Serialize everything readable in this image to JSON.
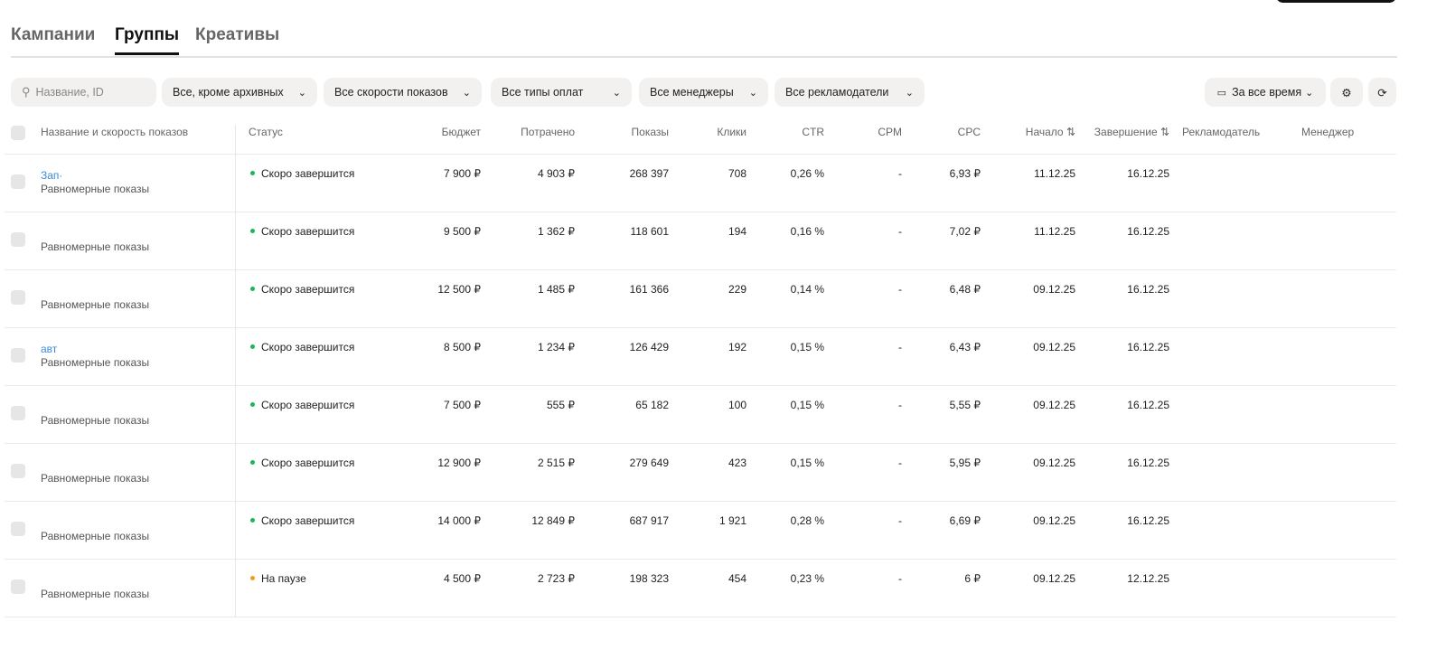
{
  "tabs": [
    "Кампании",
    "Группы",
    "Креативы"
  ],
  "filters": {
    "search_placeholder": "Название, ID",
    "status": "Все, кроме архивных",
    "speed": "Все скорости показов",
    "payment": "Все типы оплат",
    "managers": "Все менеджеры",
    "advertisers": "Все рекламодатели",
    "period": "За все время"
  },
  "columns": [
    "Название и скорость показов",
    "Статус",
    "Бюджет",
    "Потрачено",
    "Показы",
    "Клики",
    "CTR",
    "CPM",
    "CPC",
    "Начало ⇅",
    "Завершение ⇅",
    "Рекламодатель",
    "Менеджер"
  ],
  "colors": {
    "green": "#22b35a",
    "orange": "#f59a1b",
    "link": "#3a8bd6"
  },
  "rows": [
    {
      "name": "Зап·",
      "speed": "Равномерные показы",
      "status": "Скоро завершится",
      "status_color": "green",
      "budget": "7 900 ₽",
      "spent": "4 903 ₽",
      "shows": "268 397",
      "clicks": "708",
      "ctr": "0,26 %",
      "cpm": "-",
      "cpc": "6,93 ₽",
      "start": "11.12.25",
      "end": "16.12.25"
    },
    {
      "name": "",
      "speed": "Равномерные показы",
      "status": "Скоро завершится",
      "status_color": "green",
      "budget": "9 500 ₽",
      "spent": "1 362 ₽",
      "shows": "118 601",
      "clicks": "194",
      "ctr": "0,16 %",
      "cpm": "-",
      "cpc": "7,02 ₽",
      "start": "11.12.25",
      "end": "16.12.25"
    },
    {
      "name": "",
      "speed": "Равномерные показы",
      "status": "Скоро завершится",
      "status_color": "green",
      "budget": "12 500 ₽",
      "spent": "1 485 ₽",
      "shows": "161 366",
      "clicks": "229",
      "ctr": "0,14 %",
      "cpm": "-",
      "cpc": "6,48 ₽",
      "start": "09.12.25",
      "end": "16.12.25"
    },
    {
      "name": "авт",
      "speed": "Равномерные показы",
      "status": "Скоро завершится",
      "status_color": "green",
      "budget": "8 500 ₽",
      "spent": "1 234 ₽",
      "shows": "126 429",
      "clicks": "192",
      "ctr": "0,15 %",
      "cpm": "-",
      "cpc": "6,43 ₽",
      "start": "09.12.25",
      "end": "16.12.25"
    },
    {
      "name": "",
      "speed": "Равномерные показы",
      "status": "Скоро завершится",
      "status_color": "green",
      "budget": "7 500 ₽",
      "spent": "555 ₽",
      "shows": "65 182",
      "clicks": "100",
      "ctr": "0,15 %",
      "cpm": "-",
      "cpc": "5,55 ₽",
      "start": "09.12.25",
      "end": "16.12.25"
    },
    {
      "name": "",
      "speed": "Равномерные показы",
      "status": "Скоро завершится",
      "status_color": "green",
      "budget": "12 900 ₽",
      "spent": "2 515 ₽",
      "shows": "279 649",
      "clicks": "423",
      "ctr": "0,15 %",
      "cpm": "-",
      "cpc": "5,95 ₽",
      "start": "09.12.25",
      "end": "16.12.25"
    },
    {
      "name": "",
      "speed": "Равномерные показы",
      "status": "Скоро завершится",
      "status_color": "green",
      "budget": "14 000 ₽",
      "spent": "12 849 ₽",
      "shows": "687 917",
      "clicks": "1 921",
      "ctr": "0,28 %",
      "cpm": "-",
      "cpc": "6,69 ₽",
      "start": "09.12.25",
      "end": "16.12.25"
    },
    {
      "name": "",
      "speed": "Равномерные показы",
      "status": "На паузе",
      "status_color": "orange",
      "budget": "4 500 ₽",
      "spent": "2 723 ₽",
      "shows": "198 323",
      "clicks": "454",
      "ctr": "0,23 %",
      "cpm": "-",
      "cpc": "6 ₽",
      "start": "09.12.25",
      "end": "12.12.25"
    }
  ]
}
